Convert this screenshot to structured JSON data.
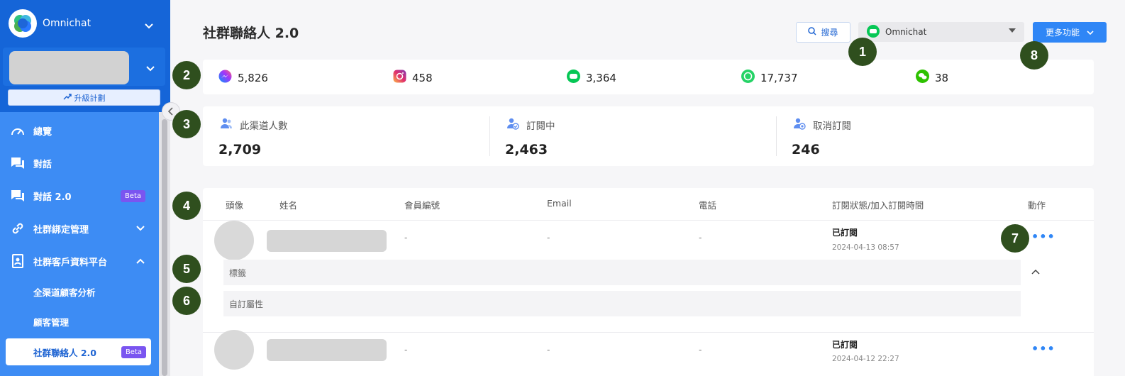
{
  "sidebar": {
    "brand_name": "Omnichat",
    "upgrade_label": "升級計劃",
    "items": [
      {
        "label": "總覽",
        "icon": "gauge-icon"
      },
      {
        "label": "對話",
        "icon": "chat-icon"
      },
      {
        "label": "對話 2.0",
        "icon": "chat-icon",
        "badge": "Beta"
      },
      {
        "label": "社群綁定管理",
        "icon": "link-icon"
      },
      {
        "label": "社群客戶資料平台",
        "icon": "contacts-icon"
      }
    ],
    "sub_items": [
      {
        "label": "全渠道顧客分析"
      },
      {
        "label": "顧客管理"
      },
      {
        "label": "社群聯絡人 2.0",
        "badge": "Beta"
      }
    ]
  },
  "header": {
    "title": "社群聯絡人 2.0",
    "search_label": "搜尋",
    "channel_value": "Omnichat",
    "more_label": "更多功能"
  },
  "channel_stats": [
    {
      "icon": "messenger-icon",
      "value": "5,826",
      "color": "#7b3ff2"
    },
    {
      "icon": "instagram-icon",
      "value": "458",
      "color": "#e1306c"
    },
    {
      "icon": "line-icon",
      "value": "3,364",
      "color": "#06c755"
    },
    {
      "icon": "whatsapp-icon",
      "value": "17,737",
      "color": "#25d366"
    },
    {
      "icon": "wechat-icon",
      "value": "38",
      "color": "#2dc100"
    }
  ],
  "subscriptions": [
    {
      "label": "此渠道人數",
      "value": "2,709"
    },
    {
      "label": "訂閱中",
      "value": "2,463"
    },
    {
      "label": "取消訂閱",
      "value": "246"
    }
  ],
  "table": {
    "headers": [
      "頭像",
      "姓名",
      "會員編號",
      "Email",
      "電話",
      "訂閱狀態/加入訂閱時間",
      "動作"
    ],
    "rows": [
      {
        "member_id": "-",
        "email": "-",
        "phone": "-",
        "status": "已訂閱",
        "time": "2024-04-13 08:57"
      },
      {
        "member_id": "-",
        "email": "-",
        "phone": "-",
        "status": "已訂閱",
        "time": "2024-04-12 22:27"
      }
    ],
    "expand_tag_label": "標籤",
    "expand_attr_label": "自訂屬性"
  },
  "annotations": [
    "1",
    "2",
    "3",
    "4",
    "5",
    "6",
    "7",
    "8"
  ],
  "colors": {
    "sidebar_dark": "#1565d8",
    "sidebar_menu": "#3d8cf4",
    "accent": "#2f86f6",
    "badge": "#2f4f1e",
    "beta": "#7a55f0"
  }
}
